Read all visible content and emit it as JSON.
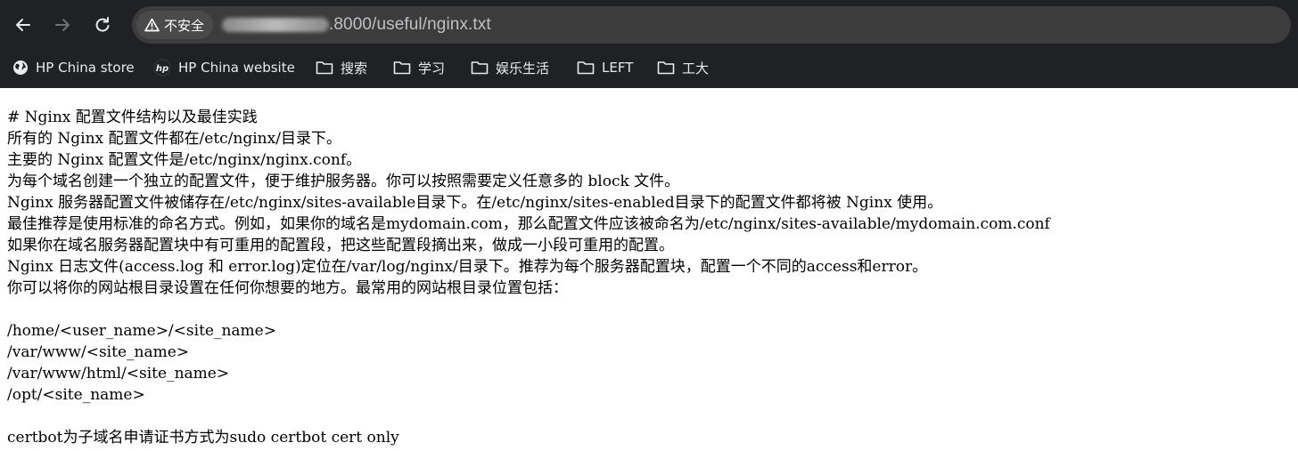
{
  "browser": {
    "security_label": "不安全",
    "url_suffix": ".8000/useful/nginx.txt"
  },
  "bookmarks": [
    {
      "label": "HP China store",
      "icon": "globe-icon"
    },
    {
      "label": "HP China website",
      "icon": "hp-logo-icon"
    },
    {
      "label": "搜索",
      "icon": "folder-icon"
    },
    {
      "label": "学习",
      "icon": "folder-icon"
    },
    {
      "label": "娱乐生活",
      "icon": "folder-icon"
    },
    {
      "label": "LEFT",
      "icon": "folder-icon"
    },
    {
      "label": "工大",
      "icon": "folder-icon"
    }
  ],
  "document": {
    "lines": [
      "# Nginx 配置文件结构以及最佳实践",
      "所有的 Nginx 配置文件都在/etc/nginx/目录下。",
      "主要的 Nginx 配置文件是/etc/nginx/nginx.conf。",
      "为每个域名创建一个独立的配置文件，便于维护服务器。你可以按照需要定义任意多的 block 文件。",
      "Nginx 服务器配置文件被储存在/etc/nginx/sites-available目录下。在/etc/nginx/sites-enabled目录下的配置文件都将被 Nginx 使用。",
      "最佳推荐是使用标准的命名方式。例如，如果你的域名是mydomain.com，那么配置文件应该被命名为/etc/nginx/sites-available/mydomain.com.conf",
      "如果你在域名服务器配置块中有可重用的配置段，把这些配置段摘出来，做成一小段可重用的配置。",
      "Nginx 日志文件(access.log 和 error.log)定位在/var/log/nginx/目录下。推荐为每个服务器配置块，配置一个不同的access和error。",
      "你可以将你的网站根目录设置在任何你想要的地方。最常用的网站根目录位置包括：",
      "",
      "/home/<user_name>/<site_name>",
      "/var/www/<site_name>",
      "/var/www/html/<site_name>",
      "/opt/<site_name>",
      "",
      "certbot为子域名申请证书方式为sudo certbot cert only"
    ]
  }
}
